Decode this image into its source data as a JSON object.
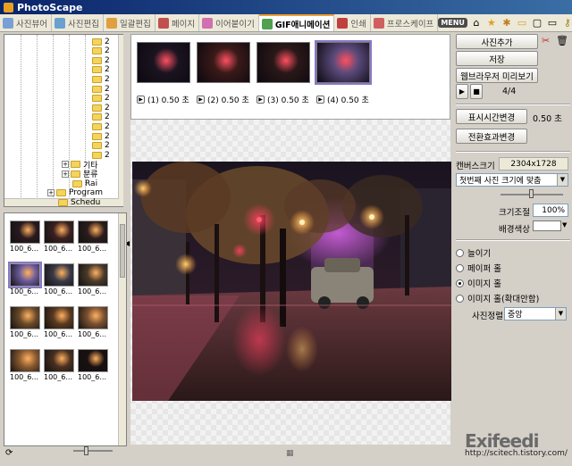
{
  "window": {
    "title": "PhotoScape"
  },
  "tabs": [
    {
      "label": "사진뷰어",
      "icon": "viewer-icon",
      "color": "#7a9fd4"
    },
    {
      "label": "사진편집",
      "icon": "editor-icon",
      "color": "#6aa0d0"
    },
    {
      "label": "일괄편집",
      "icon": "batch-icon",
      "color": "#e0a040"
    },
    {
      "label": "페이지",
      "icon": "page-icon",
      "color": "#c05050"
    },
    {
      "label": "이어붙이기",
      "icon": "combine-icon",
      "color": "#d070b0"
    },
    {
      "label": "GIF애니메이션",
      "icon": "gif-icon",
      "color": "#50a050",
      "active": true
    },
    {
      "label": "인쇄",
      "icon": "print-icon",
      "color": "#c04040"
    },
    {
      "label": "프로스케이프",
      "icon": "splitter-icon",
      "color": "#d06060"
    }
  ],
  "toolbar": {
    "menu_label": "MENU"
  },
  "tree": {
    "nodes": [
      {
        "label": "2",
        "depth": 3,
        "folder": true
      },
      {
        "label": "2",
        "depth": 3,
        "folder": true
      },
      {
        "label": "2",
        "depth": 3,
        "folder": true
      },
      {
        "label": "2",
        "depth": 3,
        "folder": true
      },
      {
        "label": "2",
        "depth": 3,
        "folder": true
      },
      {
        "label": "2",
        "depth": 3,
        "folder": true
      },
      {
        "label": "2",
        "depth": 3,
        "folder": true
      },
      {
        "label": "2",
        "depth": 3,
        "folder": true
      },
      {
        "label": "2",
        "depth": 3,
        "folder": true
      },
      {
        "label": "2",
        "depth": 3,
        "folder": true
      },
      {
        "label": "2",
        "depth": 3,
        "folder": true
      },
      {
        "label": "2",
        "depth": 3,
        "folder": true
      },
      {
        "label": "2",
        "depth": 3,
        "folder": true
      },
      {
        "label": "기타",
        "depth": 2,
        "folder": true,
        "expander": "+"
      },
      {
        "label": "분류",
        "depth": 2,
        "folder": true,
        "expander": "+"
      },
      {
        "label": "Rai",
        "depth": 2,
        "folder": true
      },
      {
        "label": "Program",
        "depth": 1,
        "folder": true,
        "expander": "+"
      },
      {
        "label": "Schedu",
        "depth": 1,
        "folder": true
      }
    ]
  },
  "thumbnails": [
    {
      "caption": "100_6...",
      "tone": "#2a1a20"
    },
    {
      "caption": "100_6...",
      "tone": "#3a2020"
    },
    {
      "caption": "100_6...",
      "tone": "#2c1c1c"
    },
    {
      "caption": "100_6...",
      "tone": "#6a5a9a",
      "selected": true
    },
    {
      "caption": "100_6...",
      "tone": "#3a3a48"
    },
    {
      "caption": "100_6...",
      "tone": "#4a3a2a"
    },
    {
      "caption": "100_6...",
      "tone": "#6a4a2a"
    },
    {
      "caption": "100_6...",
      "tone": "#5a3a20"
    },
    {
      "caption": "100_6...",
      "tone": "#7a5030"
    },
    {
      "caption": "100_6...",
      "tone": "#8a5a30"
    },
    {
      "caption": "100_6...",
      "tone": "#4a3020"
    },
    {
      "caption": "100_6...",
      "tone": "#1a1010"
    }
  ],
  "frames": [
    {
      "label": "(1) 0.50 초",
      "tone": "#1a1420"
    },
    {
      "label": "(2) 0.50 초",
      "tone": "#3a1a18"
    },
    {
      "label": "(3) 0.50 초",
      "tone": "#2a1818"
    },
    {
      "label": "(4) 0.50 초",
      "tone": "#5a4a7a",
      "selected": true
    }
  ],
  "panel": {
    "add_photo": "사진추가",
    "save": "저장",
    "browser_preview": "웹브라우저 미리보기",
    "frame_counter": "4/4",
    "change_display_time": "표시시간변경",
    "display_time_value": "0.50 초",
    "change_transition": "전환효과변경",
    "canvas_size_label": "캔버스크기",
    "canvas_size_value": "2304x1728",
    "fit_option": "첫번째 사진 크기에 맞춤",
    "size_adjust_label": "크기조절",
    "size_adjust_value": "100%",
    "bg_color_label": "배경색상",
    "radios": [
      {
        "label": "늘이기",
        "checked": false
      },
      {
        "label": "페이퍼 홀",
        "checked": false
      },
      {
        "label": "이미지 홀",
        "checked": true
      },
      {
        "label": "이미지 홀(확대안함)",
        "checked": false
      }
    ],
    "align_label": "사진정렬",
    "align_value": "중앙"
  },
  "watermark": {
    "logo": "Exifeedi",
    "url": "http://scitech.tistory.com/"
  }
}
